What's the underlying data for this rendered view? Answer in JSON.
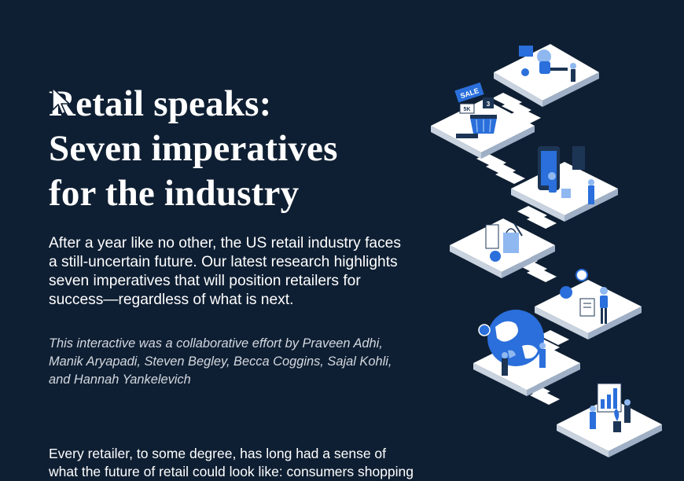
{
  "article": {
    "title_lines": [
      "Retail speaks:",
      "Seven imperatives",
      "for the industry"
    ],
    "intro_lines": [
      "After a year like no other, the US retail industry faces",
      "a still-uncertain future. Our latest research highlights",
      "seven imperatives that will position retailers for",
      "success—regardless of what is next."
    ],
    "credit_lines": [
      "This interactive was a collaborative effort by Praveen Adhi,",
      "Manik Aryapadi, Steven Begley, Becca Coggins, Sajal Kohli,",
      "and Hannah Yankelevich"
    ],
    "body_lines": [
      "Every retailer, to some degree, has long had a sense of",
      "what the future of retail could look like: consumers shopping"
    ]
  },
  "illustration": {
    "sale_tag": "SALE",
    "price_tag": "5K",
    "counter_tag": "3"
  },
  "colors": {
    "background": "#0f1f33",
    "accent_blue": "#2a6fdb",
    "light_blue": "#8fb8f0",
    "platform": "#ffffff",
    "platform_side": "#c9d3e0"
  }
}
